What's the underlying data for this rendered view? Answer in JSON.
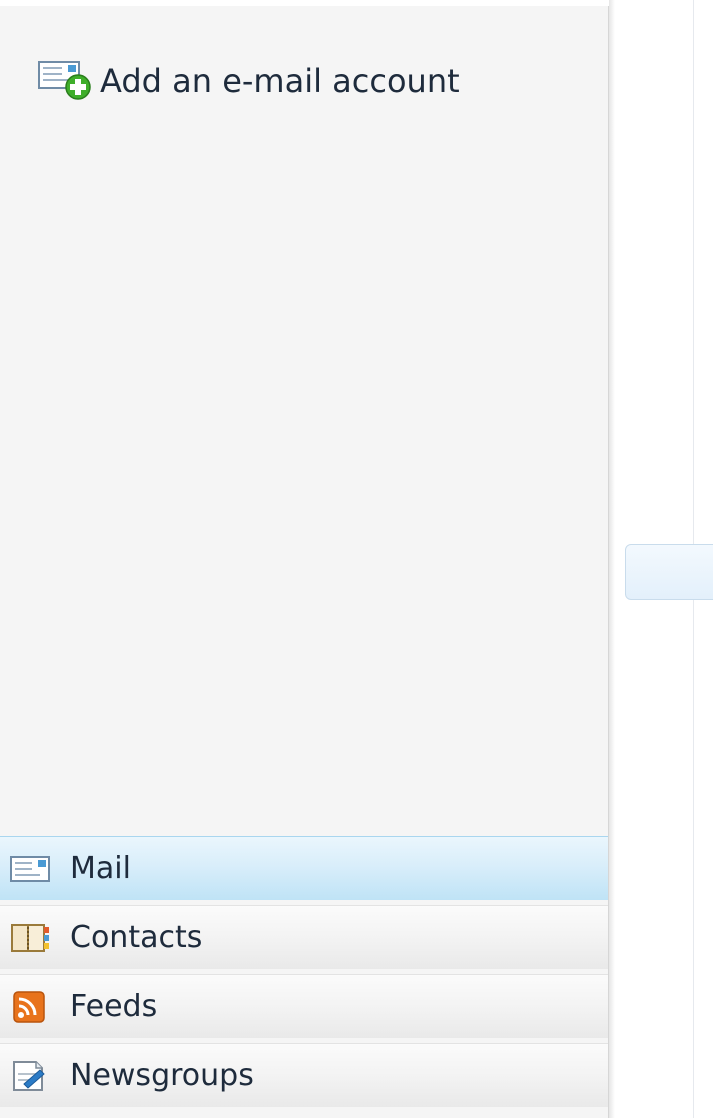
{
  "left_pane": {
    "add_account": {
      "label": "Add an e-mail account",
      "icon": "add-mail-account-icon"
    }
  },
  "nav": {
    "items": [
      {
        "label": "Mail",
        "icon": "mail-icon",
        "selected": true
      },
      {
        "label": "Contacts",
        "icon": "contacts-icon",
        "selected": false
      },
      {
        "label": "Feeds",
        "icon": "feeds-icon",
        "selected": false
      },
      {
        "label": "Newsgroups",
        "icon": "newsgroups-icon",
        "selected": false
      }
    ]
  },
  "colors": {
    "selected_bg": "#d9eefa",
    "text": "#1e2b3c",
    "feeds_orange": "#e8731c"
  }
}
